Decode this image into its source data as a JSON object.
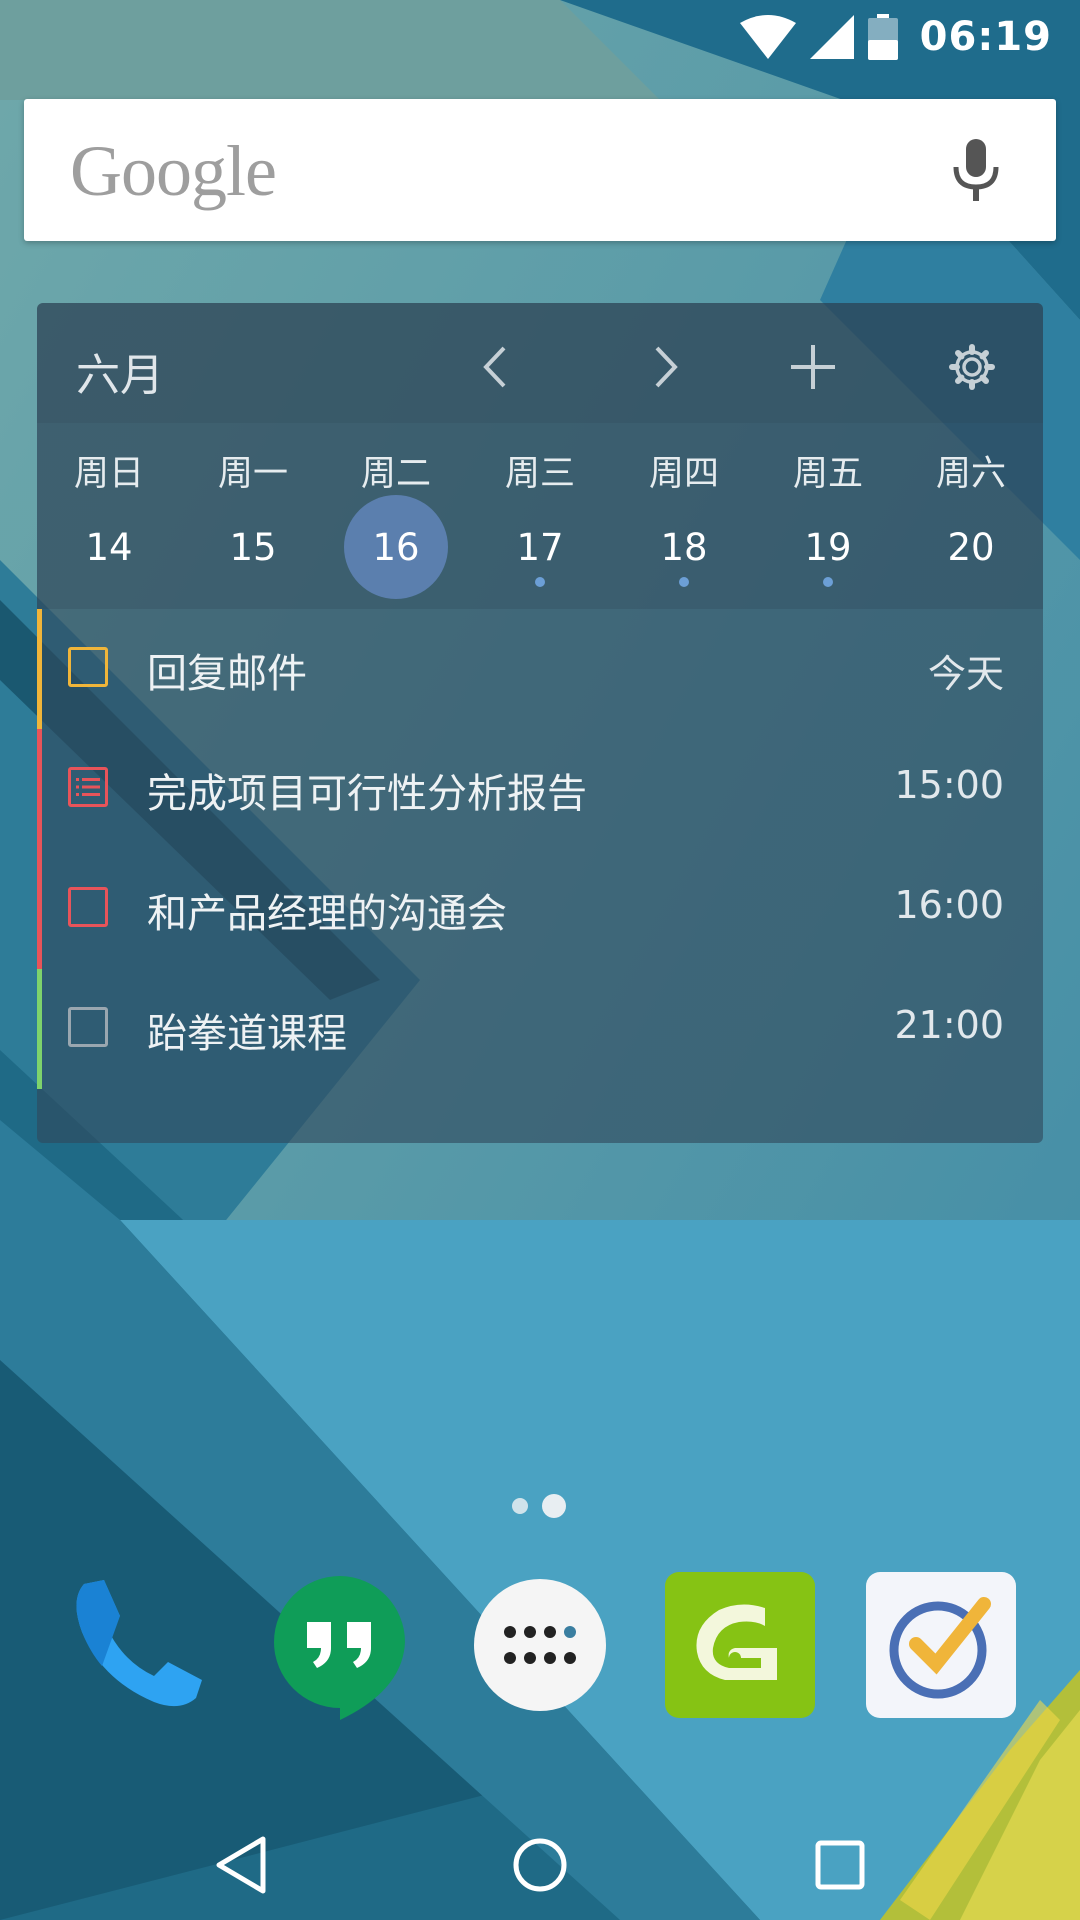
{
  "status_bar": {
    "time": "06:19",
    "icons": [
      "wifi-icon",
      "cell-signal-icon",
      "battery-icon"
    ]
  },
  "search": {
    "logo_text": "Google",
    "icons": [
      "mic-icon"
    ]
  },
  "calendar_widget": {
    "month": "六月",
    "header_icons": [
      "chevron-left-icon",
      "chevron-right-icon",
      "plus-icon",
      "gear-icon"
    ],
    "days": [
      {
        "name": "周日",
        "num": "14",
        "selected": false,
        "has_event": false
      },
      {
        "name": "周一",
        "num": "15",
        "selected": false,
        "has_event": false
      },
      {
        "name": "周二",
        "num": "16",
        "selected": true,
        "has_event": false
      },
      {
        "name": "周三",
        "num": "17",
        "selected": false,
        "has_event": true
      },
      {
        "name": "周四",
        "num": "18",
        "selected": false,
        "has_event": true
      },
      {
        "name": "周五",
        "num": "19",
        "selected": false,
        "has_event": true
      },
      {
        "name": "周六",
        "num": "20",
        "selected": false,
        "has_event": false
      }
    ],
    "tasks": [
      {
        "title": "回复邮件",
        "time": "今天",
        "color": "#f0b53a",
        "type": "checkbox"
      },
      {
        "title": "完成项目可行性分析报告",
        "time": "15:00",
        "color": "#e8545a",
        "type": "checklist"
      },
      {
        "title": "和产品经理的沟通会",
        "time": "16:00",
        "color": "#e8545a",
        "type": "checkbox"
      },
      {
        "title": "跆拳道课程",
        "time": "21:00",
        "color": "#7ed36c",
        "type": "checkbox"
      }
    ],
    "colors": {
      "selected_day": "#5b7fae",
      "event_dot": "#6c9fd6"
    }
  },
  "home": {
    "page_count": 2,
    "active_page": 2
  },
  "dock": [
    {
      "name": "phone-app-icon"
    },
    {
      "name": "hangouts-app-icon"
    },
    {
      "name": "app-drawer-icon"
    },
    {
      "name": "green-g-app-icon"
    },
    {
      "name": "ticktick-app-icon"
    }
  ],
  "nav_bar": {
    "icons": [
      "back-icon",
      "home-icon",
      "recents-icon"
    ]
  }
}
